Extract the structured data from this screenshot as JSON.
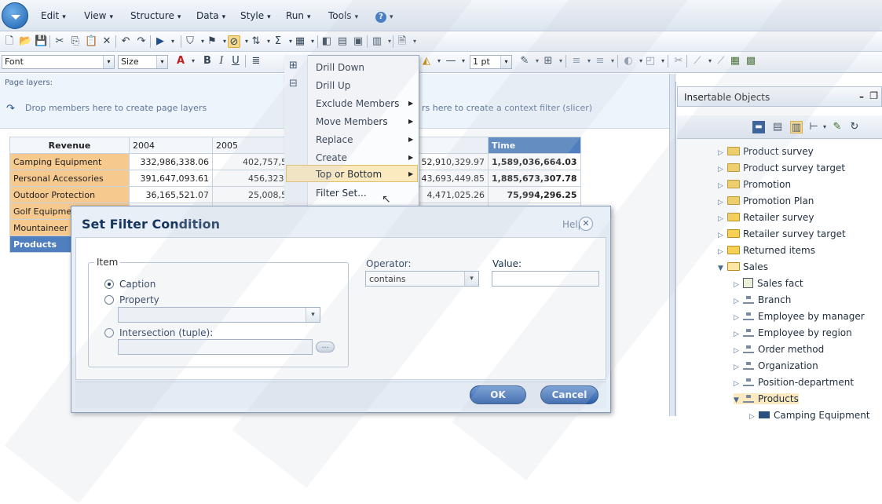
{
  "menubar": {
    "items": [
      {
        "label": "Edit"
      },
      {
        "label": "View"
      },
      {
        "label": "Structure"
      },
      {
        "label": "Data"
      },
      {
        "label": "Style"
      },
      {
        "label": "Run"
      },
      {
        "label": "Tools"
      }
    ]
  },
  "toolbar2": {
    "font_value": "Font",
    "size_value": "Size",
    "line_width_value": "1 pt"
  },
  "page_layers": {
    "label": "Page layers:",
    "hint": "Drop members here to create page layers",
    "context_hint": "rs here to create a context filter (slicer)"
  },
  "grid": {
    "corner": "Revenue",
    "columns": [
      "2004",
      "2005"
    ],
    "total_col": "Time",
    "rows": [
      {
        "label": "Camping Equipment",
        "c1": "332,986,338.06",
        "c2": "402,757,57",
        "c4": "52,910,329.97",
        "total": "1,589,036,664.03"
      },
      {
        "label": "Personal Accessories",
        "c1": "391,647,093.61",
        "c2": "456,323,3",
        "c4": "43,693,449.85",
        "total": "1,885,673,307.78"
      },
      {
        "label": "Outdoor Protection",
        "c1": "36,165,521.07",
        "c2": "25,008,57",
        "c4": "4,471,025.26",
        "total": "75,994,296.25"
      },
      {
        "label": "Golf Equipme"
      },
      {
        "label": "Mountaineer"
      }
    ],
    "products_label": "Products"
  },
  "context_menu": {
    "items": [
      {
        "label": "Drill Down",
        "submenu": false
      },
      {
        "label": "Drill Up",
        "submenu": false
      },
      {
        "label": "Exclude Members",
        "submenu": true
      },
      {
        "label": "Move Members",
        "submenu": true
      },
      {
        "label": "Replace",
        "submenu": true
      },
      {
        "label": "Create",
        "submenu": true
      },
      {
        "label": "Top or Bottom",
        "submenu": true
      },
      {
        "label": "Filter Set...",
        "submenu": false
      }
    ],
    "highlighted": "Filter Set..."
  },
  "dialog": {
    "title": "Set Filter Condition",
    "help": "Help",
    "item_legend": "Item",
    "caption_label": "Caption",
    "property_label": "Property",
    "intersection_label": "Intersection (tuple):",
    "operator_label": "Operator:",
    "operator_value": "contains",
    "value_label": "Value:",
    "value_value": "",
    "ok_label": "OK",
    "cancel_label": "Cancel",
    "selected_item": "Caption"
  },
  "right_panel": {
    "title": "Insertable Objects",
    "tree": [
      {
        "label": "Product survey",
        "type": "folder",
        "expanded": false
      },
      {
        "label": "Product survey target",
        "type": "folder",
        "expanded": false
      },
      {
        "label": "Promotion",
        "type": "folder",
        "expanded": false
      },
      {
        "label": "Promotion Plan",
        "type": "folder",
        "expanded": false
      },
      {
        "label": "Retailer survey",
        "type": "folder",
        "expanded": false
      },
      {
        "label": "Retailer survey target",
        "type": "folder",
        "expanded": false
      },
      {
        "label": "Returned items",
        "type": "folder",
        "expanded": false
      },
      {
        "label": "Sales",
        "type": "folder",
        "expanded": true
      },
      {
        "label": "Sales fact",
        "type": "measure",
        "expanded": false
      },
      {
        "label": "Branch",
        "type": "dimension",
        "expanded": false
      },
      {
        "label": "Employee by manager",
        "type": "dimension",
        "expanded": false
      },
      {
        "label": "Employee by region",
        "type": "dimension",
        "expanded": false
      },
      {
        "label": "Order method",
        "type": "dimension",
        "expanded": false
      },
      {
        "label": "Organization",
        "type": "dimension",
        "expanded": false
      },
      {
        "label": "Position-department",
        "type": "dimension",
        "expanded": false
      },
      {
        "label": "Products",
        "type": "dimension",
        "expanded": true
      },
      {
        "label": "Camping Equipment",
        "type": "level",
        "expanded": false
      }
    ]
  },
  "colors": {
    "accent": "#2d5ea8",
    "row_header": "#f6c98f",
    "time_header": "#4f7fbe",
    "menu_highlight": "#fbeac0"
  }
}
